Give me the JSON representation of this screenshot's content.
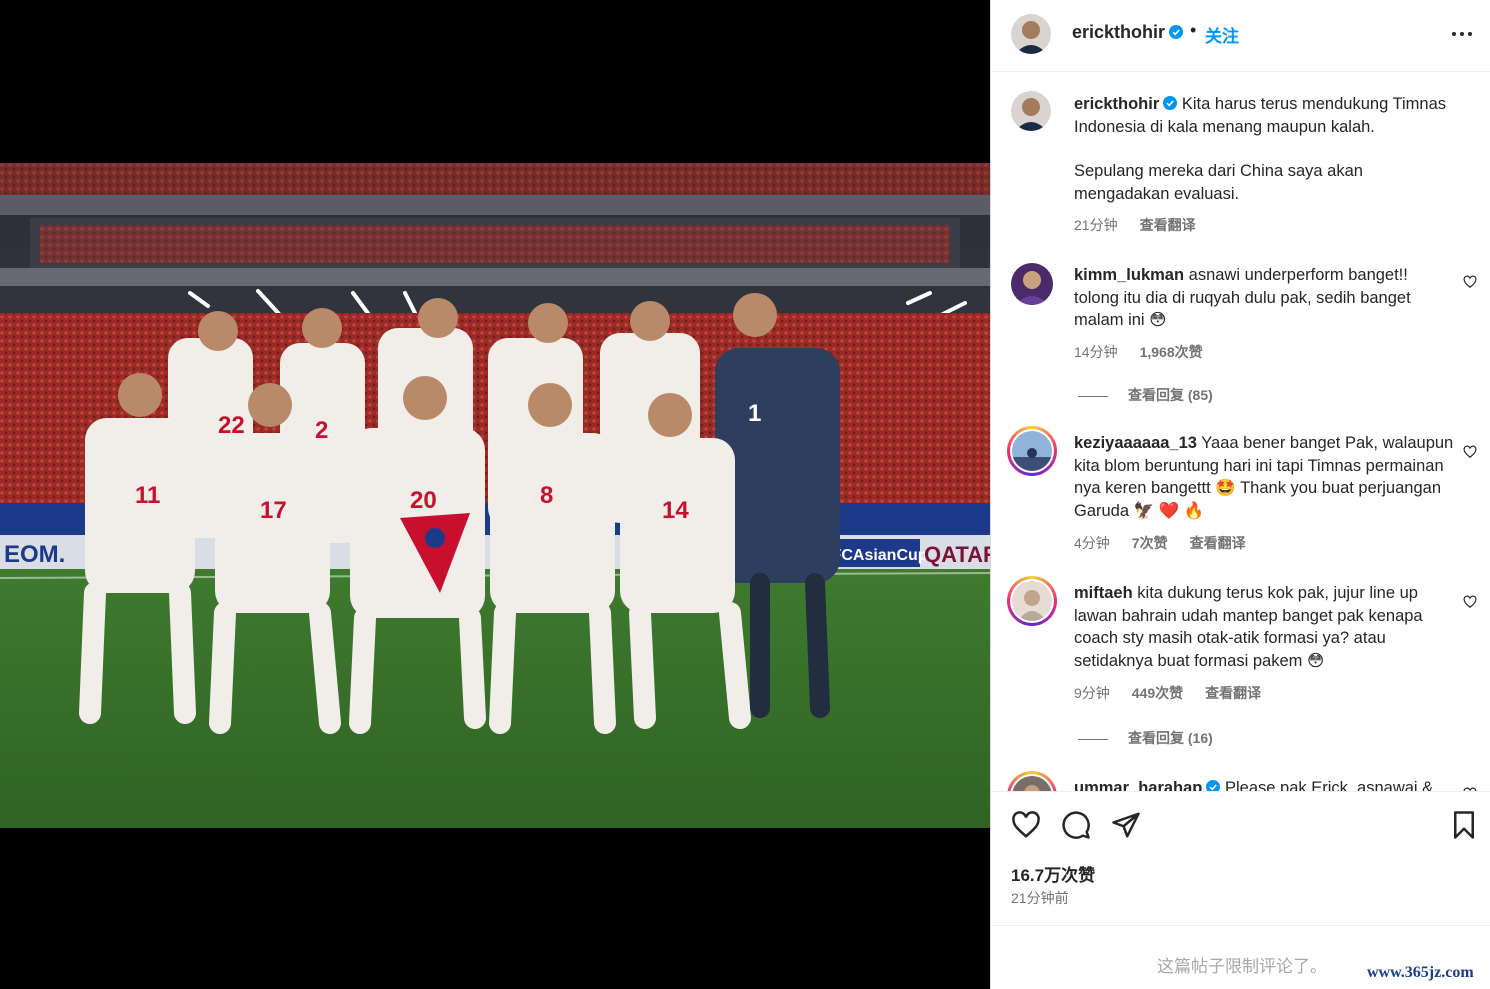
{
  "post": {
    "image_alt": "Indonesia national football team photo",
    "photo_texts": {
      "board_left": "EOM.",
      "board_right": "AFCAsianCup",
      "board_qatar": "QATAR"
    }
  },
  "header": {
    "username": "erickthohir",
    "separator": "•",
    "follow_label": "关注"
  },
  "caption": {
    "username": "erickthohir",
    "text_1": "Kita harus terus mendukung Timnas Indonesia di kala menang maupun kalah.",
    "text_2": "Sepulang mereka dari China saya akan mengadakan evaluasi.",
    "time": "21分钟",
    "translate": "查看翻译"
  },
  "comments": [
    {
      "username": "kimm_lukman",
      "text": "asnawi underperform banget!! tolong itu dia di ruqyah dulu pak, sedih banget malam ini 😳",
      "time": "14分钟",
      "likes": "1,968次赞",
      "replies": "查看回复 (85)"
    },
    {
      "username": "keziyaaaaaa_13",
      "text": "Yaaa bener banget Pak, walaupun kita blom beruntung hari ini tapi Timnas permainan nya keren bangettt 🤩 Thank you buat perjuangan Garuda 🦅 ❤️ 🔥",
      "time": "4分钟",
      "likes": "7次赞",
      "translate": "查看翻译"
    },
    {
      "username": "miftaeh",
      "text": "kita dukung terus kok pak, jujur line up lawan bahrain udah mantep banget pak kenapa coach sty masih otak-atik formasi ya? atau setidaknya buat formasi pakem 😳",
      "time": "9分钟",
      "likes": "449次赞",
      "translate": "查看翻译",
      "replies": "查看回复 (16)"
    },
    {
      "username": "ummar_harahap",
      "text": "Please pak Erick, asnawai &"
    }
  ],
  "actions": {
    "likes": "16.7万次赞",
    "time": "21分钟前"
  },
  "footer": {
    "closed_text": "这篇帖子限制评论了。",
    "watermark": "www.365jz.com"
  },
  "colors": {
    "accent": "#0095f6",
    "text": "#262626",
    "muted": "#737373",
    "like_red": "#ed4956"
  }
}
